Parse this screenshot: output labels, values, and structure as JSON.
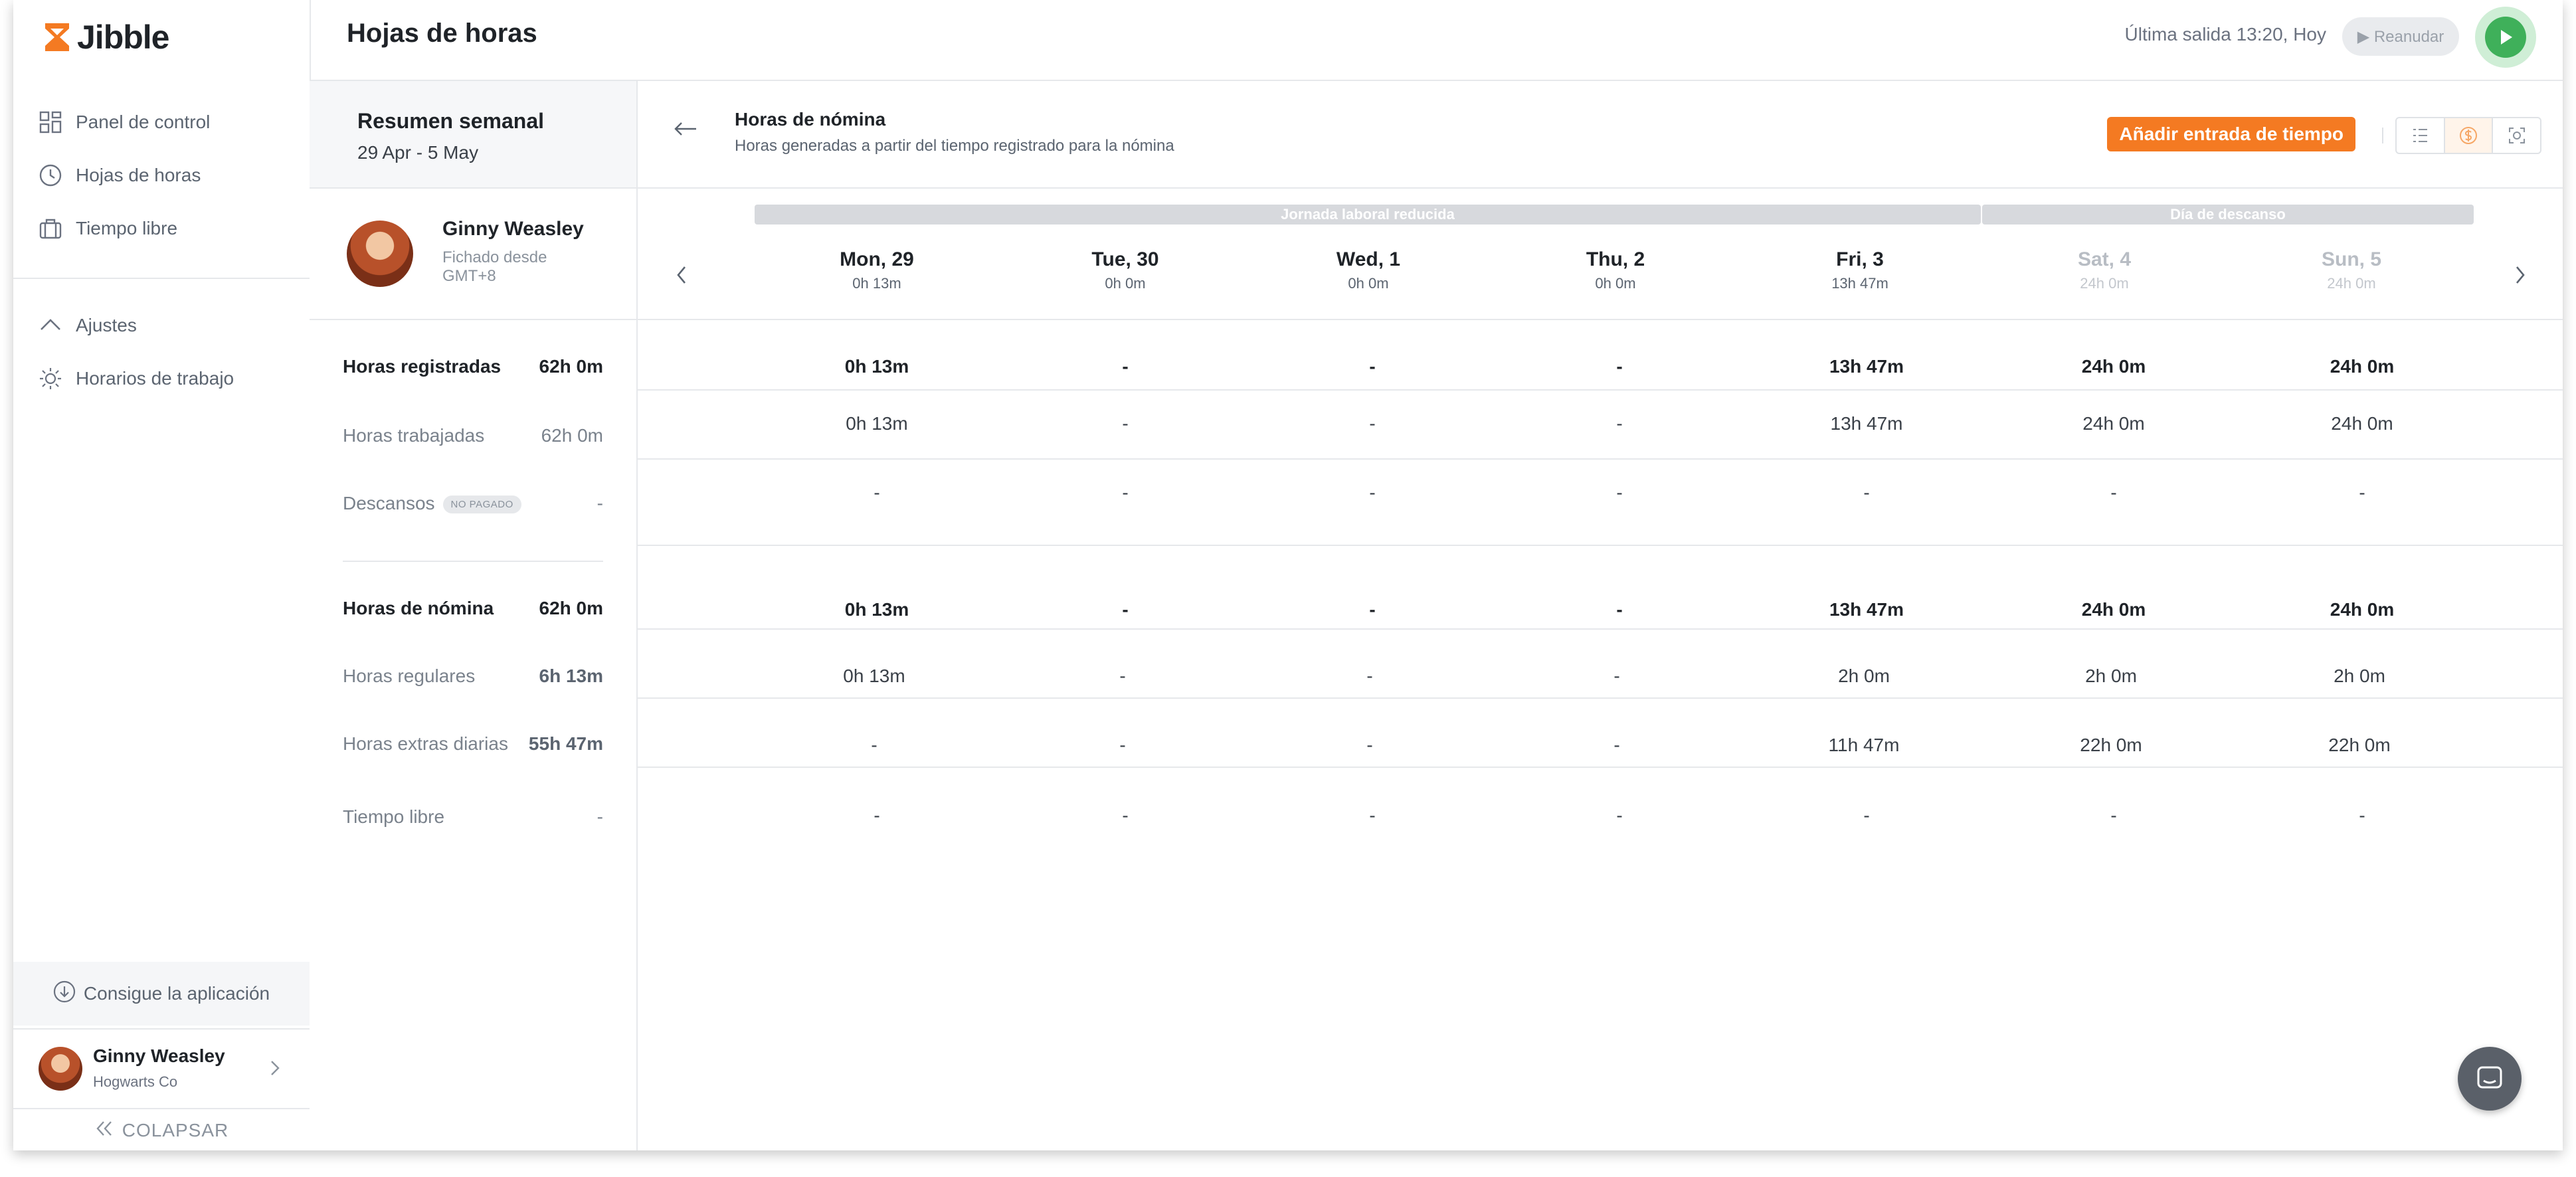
{
  "app": {
    "logo_text": "Jibble",
    "brand_color": "#f47a22"
  },
  "sidebar": {
    "items": [
      {
        "label": "Panel de control",
        "icon": "dashboard-icon"
      },
      {
        "label": "Hojas de horas",
        "icon": "clock-icon"
      },
      {
        "label": "Tiempo libre",
        "icon": "suitcase-icon"
      }
    ],
    "section": {
      "label": "Ajustes",
      "icon": "chevron-up-icon"
    },
    "sub_items": [
      {
        "label": "Horarios de trabajo",
        "icon": "sun-icon"
      }
    ],
    "get_app": "Consigue la aplicación",
    "user": {
      "name": "Ginny Weasley",
      "org": "Hogwarts Co"
    },
    "collapse": "COLAPSAR"
  },
  "header": {
    "title": "Hojas de horas",
    "last_out": "Última salida 13:20, Hoy",
    "resume_label": "▶ Reanudar"
  },
  "summary": {
    "title": "Resumen semanal",
    "range": "29 Apr - 5 May",
    "employee": {
      "name": "Ginny Weasley",
      "clocked_label": "Fichado desde",
      "tz": "GMT+8"
    },
    "rows": [
      {
        "label": "Horas registradas",
        "value": "62h 0m",
        "bold": true
      },
      {
        "label": "Horas trabajadas",
        "value": "62h 0m",
        "bold": false
      },
      {
        "label": "Descansos",
        "tag": "NO PAGADO",
        "value": "-",
        "bold": false
      },
      {
        "label": "Horas de nómina",
        "value": "62h 0m",
        "bold": true
      },
      {
        "label": "Horas regulares",
        "value": "6h 13m",
        "bold": false
      },
      {
        "label": "Horas extras diarias",
        "value": "55h 47m",
        "bold": false
      },
      {
        "label": "Tiempo libre",
        "value": "-",
        "bold": false
      }
    ]
  },
  "main": {
    "title": "Horas de nómina",
    "subtitle": "Horas generadas a partir del tiempo registrado para la nómina",
    "add_button": "Añadir entrada de tiempo",
    "bands": [
      "Jornada laboral reducida",
      "Día de descanso"
    ],
    "days": [
      {
        "name": "Mon, 29",
        "total": "0h 13m",
        "muted": false
      },
      {
        "name": "Tue, 30",
        "total": "0h 0m",
        "muted": false
      },
      {
        "name": "Wed, 1",
        "total": "0h 0m",
        "muted": false
      },
      {
        "name": "Thu, 2",
        "total": "0h 0m",
        "muted": false
      },
      {
        "name": "Fri, 3",
        "total": "13h 47m",
        "muted": false
      },
      {
        "name": "Sat, 4",
        "total": "24h 0m",
        "muted": true
      },
      {
        "name": "Sun, 5",
        "total": "24h 0m",
        "muted": true
      }
    ],
    "rows": [
      {
        "bold": true,
        "values": [
          "0h 13m",
          "-",
          "-",
          "-",
          "13h 47m",
          "24h 0m",
          "24h 0m"
        ]
      },
      {
        "bold": false,
        "values": [
          "0h 13m",
          "-",
          "-",
          "-",
          "13h 47m",
          "24h 0m",
          "24h 0m"
        ]
      },
      {
        "bold": false,
        "values": [
          "-",
          "-",
          "-",
          "-",
          "-",
          "-",
          "-"
        ]
      },
      {
        "bold": true,
        "values": [
          "0h 13m",
          "-",
          "-",
          "-",
          "13h 47m",
          "24h 0m",
          "24h 0m"
        ]
      },
      {
        "bold": false,
        "values": [
          "0h 13m",
          "-",
          "-",
          "-",
          "2h 0m",
          "2h 0m",
          "2h 0m"
        ]
      },
      {
        "bold": false,
        "values": [
          "-",
          "-",
          "-",
          "-",
          "11h 47m",
          "22h 0m",
          "22h 0m"
        ]
      },
      {
        "bold": false,
        "values": [
          "-",
          "-",
          "-",
          "-",
          "-",
          "-",
          "-"
        ]
      }
    ]
  }
}
